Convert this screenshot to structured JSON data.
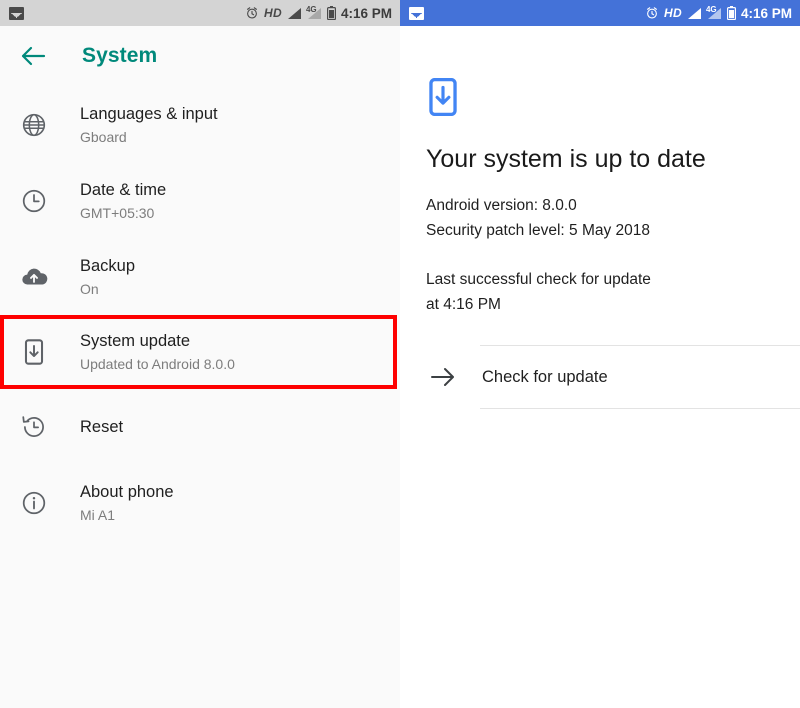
{
  "left_panel": {
    "status_bar": {
      "notification_icon": "photo-icon",
      "alarm_icon": "alarm-clock-icon",
      "hd_label": "HD",
      "signal_icon": "signal-bars-icon",
      "network_label": "4G",
      "network_signal_icon": "signal-bars-icon",
      "battery_icon": "battery-icon",
      "time": "4:16 PM"
    },
    "appbar": {
      "back_icon": "back-arrow-icon",
      "title": "System",
      "accent_color": "#00897b"
    },
    "items": [
      {
        "icon": "globe-icon",
        "title": "Languages & input",
        "subtitle": "Gboard"
      },
      {
        "icon": "clock-icon",
        "title": "Date & time",
        "subtitle": "GMT+05:30"
      },
      {
        "icon": "cloud-upload-icon",
        "title": "Backup",
        "subtitle": "On"
      },
      {
        "icon": "phone-download-icon",
        "title": "System update",
        "subtitle": "Updated to Android 8.0.0"
      },
      {
        "icon": "history-icon",
        "title": "Reset",
        "subtitle": ""
      },
      {
        "icon": "info-circle-icon",
        "title": "About phone",
        "subtitle": "Mi A1"
      }
    ],
    "highlight": {
      "target_item": "System update",
      "color": "#fe0000"
    }
  },
  "right_panel": {
    "status_bar": {
      "notification_icon": "photo-icon",
      "alarm_icon": "alarm-clock-icon",
      "hd_label": "HD",
      "signal_icon": "signal-bars-icon",
      "network_label": "4G",
      "network_signal_icon": "signal-bars-icon",
      "battery_icon": "battery-icon",
      "time": "4:16 PM",
      "background_color": "#4472d8"
    },
    "content": {
      "status_icon": "phone-download-icon",
      "status_icon_color": "#4285f4",
      "heading": "Your system is up to date",
      "android_version": "Android version: 8.0.0",
      "security_patch": "Security patch level: 5 May 2018",
      "last_check_line1": "Last successful check for update",
      "last_check_line2": "at 4:16 PM"
    },
    "action": {
      "icon": "arrow-right-icon",
      "label": "Check for update"
    }
  }
}
